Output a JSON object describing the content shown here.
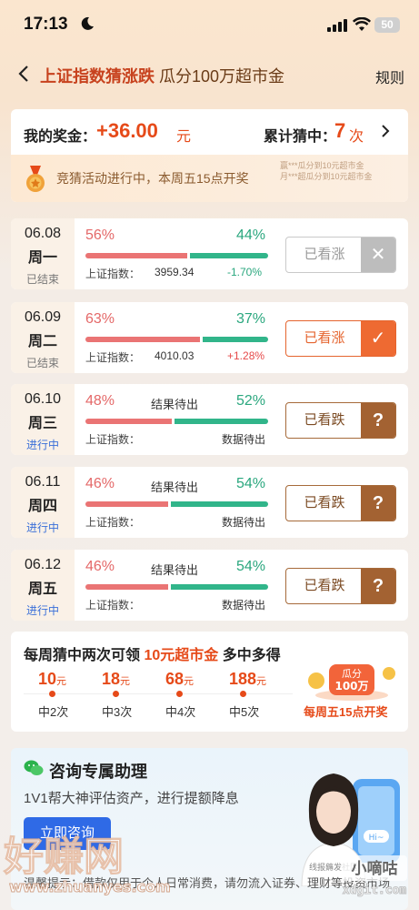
{
  "status_bar": {
    "time": "17:13",
    "battery": "50"
  },
  "nav": {
    "title_a": "上证指数猜涨跌",
    "title_b": "瓜分100万超市金",
    "rules": "规则"
  },
  "summary": {
    "prize_label": "我的奖金：",
    "prize_value": "+36.00",
    "prize_unit": "元",
    "hits_label": "累计猜中：",
    "hits_value": "7",
    "hits_unit": "次",
    "notice": "竞猜活动进行中，本周五15点开奖",
    "ticker": [
      "赢***瓜分到10元超市金",
      "月***超瓜分到10元超市金"
    ]
  },
  "days": [
    {
      "date": "06.08",
      "weekday": "周一",
      "status": "已结束",
      "live": false,
      "up_pct": "56%",
      "down_pct": "44%",
      "up": 0.56,
      "pending": "",
      "index_label": "上证指数：",
      "index_value": "3959.34",
      "change": "-1.70%",
      "change_color": "#2aa77e",
      "data_pending": "",
      "button": "已看涨",
      "mark": "✕",
      "btn_type": "btn-lost"
    },
    {
      "date": "06.09",
      "weekday": "周二",
      "status": "已结束",
      "live": false,
      "up_pct": "63%",
      "down_pct": "37%",
      "up": 0.63,
      "pending": "",
      "index_label": "上证指数：",
      "index_value": "4010.03",
      "change": "+1.28%",
      "change_color": "#e64a4a",
      "data_pending": "",
      "button": "已看涨",
      "mark": "✓",
      "btn_type": "btn-win"
    },
    {
      "date": "06.10",
      "weekday": "周三",
      "status": "进行中",
      "live": true,
      "up_pct": "48%",
      "down_pct": "52%",
      "up": 0.48,
      "pending": "结果待出",
      "index_label": "上证指数：",
      "index_value": "",
      "change": "",
      "change_color": "",
      "data_pending": "数据待出",
      "button": "已看跌",
      "mark": "?",
      "btn_type": "btn-pend"
    },
    {
      "date": "06.11",
      "weekday": "周四",
      "status": "进行中",
      "live": true,
      "up_pct": "46%",
      "down_pct": "54%",
      "up": 0.46,
      "pending": "结果待出",
      "index_label": "上证指数：",
      "index_value": "",
      "change": "",
      "change_color": "",
      "data_pending": "数据待出",
      "button": "已看跌",
      "mark": "?",
      "btn_type": "btn-pend"
    },
    {
      "date": "06.12",
      "weekday": "周五",
      "status": "进行中",
      "live": true,
      "up_pct": "46%",
      "down_pct": "54%",
      "up": 0.46,
      "pending": "结果待出",
      "index_label": "上证指数：",
      "index_value": "",
      "change": "",
      "change_color": "",
      "data_pending": "数据待出",
      "button": "已看跌",
      "mark": "?",
      "btn_type": "btn-pend"
    }
  ],
  "reward": {
    "title_a": "每周猜中两次可领",
    "title_hl": "10元超市金",
    "title_b": "多中多得",
    "tiers": [
      {
        "value": "10",
        "unit": "元",
        "label": "中2次"
      },
      {
        "value": "18",
        "unit": "元",
        "label": "中3次"
      },
      {
        "value": "68",
        "unit": "元",
        "label": "中4次"
      },
      {
        "value": "188",
        "unit": "元",
        "label": "中5次"
      }
    ],
    "jackpot_a": "瓜分",
    "jackpot_b": "100万",
    "jackpot_caption": "每周五15点开奖"
  },
  "assistant": {
    "title": "咨询专属助理",
    "subtitle": "1V1帮大神评估资产，进行提额降息",
    "button": "立即咨询",
    "disclaimer": "温馨提示：借款仅用于个人日常消费，请勿流入证券、理财等投资市场",
    "phone_label": "Hi~",
    "tag": "线报薅发社区"
  },
  "watermark": {
    "left": "好赚网",
    "site": "www.zhuanyes.com",
    "right": "小嘀咕",
    "right_site": "xdgit.com"
  },
  "colors": {
    "accent": "#e64a19",
    "up": "#ea7474",
    "down": "#31b58a",
    "link": "#2f6ae6"
  }
}
